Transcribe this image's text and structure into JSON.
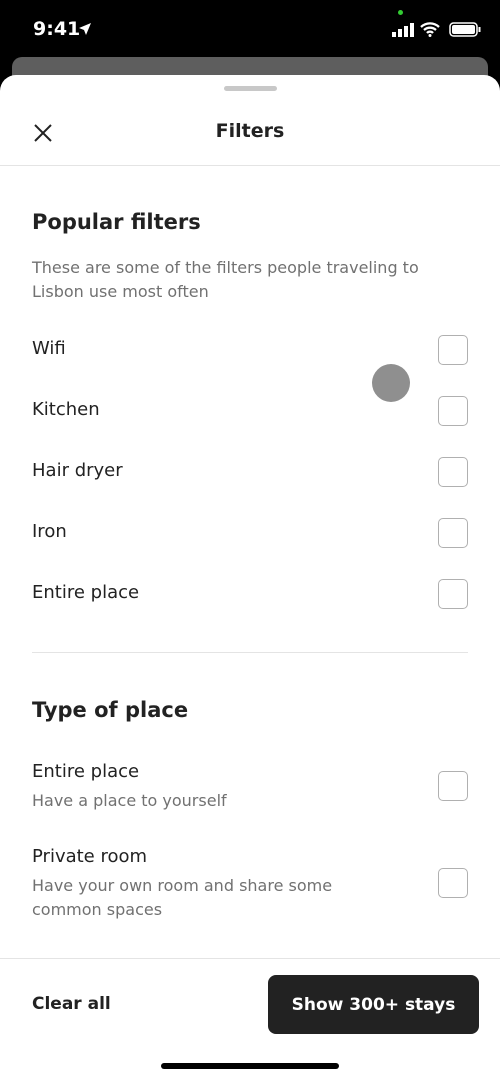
{
  "status_bar": {
    "time": "9:41"
  },
  "header": {
    "title": "Filters"
  },
  "popular": {
    "heading": "Popular filters",
    "description": "These are some of the filters people traveling to Lisbon use most often",
    "items": [
      {
        "label": "Wifi",
        "checked": false
      },
      {
        "label": "Kitchen",
        "checked": false
      },
      {
        "label": "Hair dryer",
        "checked": false
      },
      {
        "label": "Iron",
        "checked": false
      },
      {
        "label": "Entire place",
        "checked": false
      }
    ]
  },
  "type_of_place": {
    "heading": "Type of place",
    "items": [
      {
        "label": "Entire place",
        "sub": "Have a place to yourself",
        "checked": false
      },
      {
        "label": "Private room",
        "sub": "Have your own room and share some common spaces",
        "checked": false
      }
    ]
  },
  "footer": {
    "clear_label": "Clear all",
    "show_label": "Show 300+ stays"
  }
}
